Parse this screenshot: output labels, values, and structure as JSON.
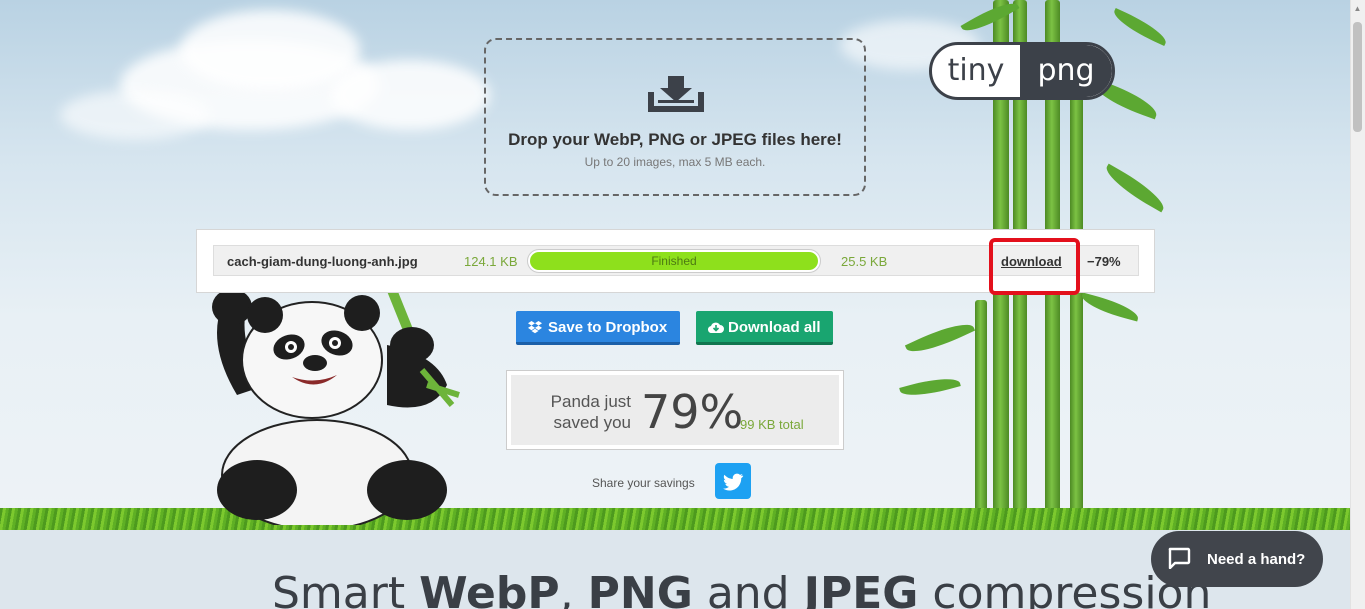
{
  "dropzone": {
    "title": "Drop your WebP, PNG or JPEG files here!",
    "subtitle": "Up to 20 images, max 5 MB each."
  },
  "logo": {
    "part1": "tiny",
    "part2": "png"
  },
  "result": {
    "filename": "cach-giam-dung-luong-anh.jpg",
    "original_size": "124.1 KB",
    "status": "Finished",
    "progress_fraction": 1.0,
    "new_size": "25.5 KB",
    "download_label": "download",
    "reduction": "−79%"
  },
  "actions": {
    "dropbox_label": "Save to Dropbox",
    "download_all_label": "Download all"
  },
  "savings": {
    "label": "Panda just saved you",
    "percent": "79%",
    "total": "99 KB total"
  },
  "share": {
    "label": "Share your savings"
  },
  "headline": {
    "prefix": "Smart ",
    "b1": "WebP",
    "mid1": ", ",
    "b2": "PNG",
    "mid2": " and ",
    "b3": "JPEG",
    "suffix": " compression"
  },
  "help": {
    "label": "Need a hand?"
  },
  "colors": {
    "accent_green": "#8ee01c",
    "dropbox_blue": "#2b85e0",
    "download_green": "#19a570",
    "highlight_red": "#e3101c",
    "twitter_blue": "#1da1f2"
  },
  "icons": [
    "download-tray-icon",
    "dropbox-icon",
    "cloud-download-icon",
    "twitter-icon",
    "chat-bubble-icon"
  ]
}
